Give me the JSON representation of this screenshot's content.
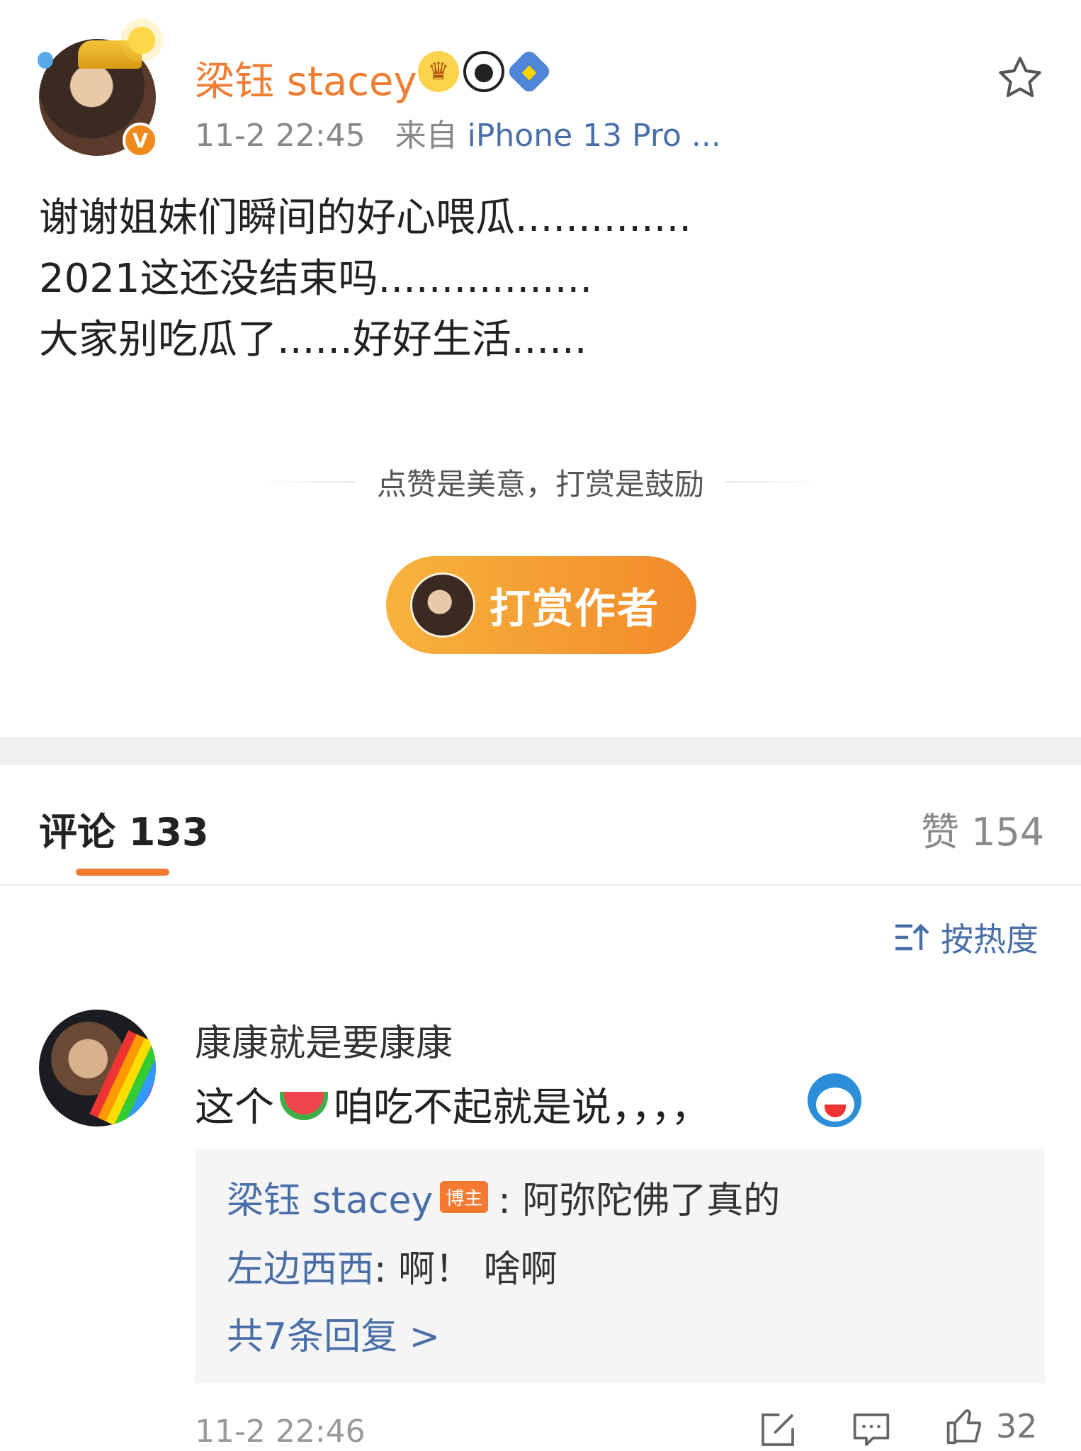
{
  "post": {
    "author": "梁钰 stacey",
    "time": "11-2 22:45",
    "source_prefix": "来自",
    "source": "iPhone 13 Pro ...",
    "text": "谢谢姐妹们瞬间的好心喂瓜..............\n2021这还没结束吗.................\n大家别吃瓜了......好好生活......",
    "badges": [
      "crown-icon",
      "panda-icon",
      "shield-icon"
    ],
    "verified_badge": "V"
  },
  "reward": {
    "slogan": "点赞是美意，打赏是鼓励",
    "button_label": "打赏作者"
  },
  "tabs": {
    "comments": "评论 133",
    "likes": "赞 154"
  },
  "sort": {
    "label": "按热度"
  },
  "comment": {
    "author": "康康就是要康康",
    "text_before": "这个",
    "text_after": "咱吃不起就是说，，，，",
    "emojis": [
      "watermelon-icon",
      "doraemon-icon"
    ],
    "replies": [
      {
        "author": "梁钰 stacey",
        "tag": "博主",
        "text": ": 阿弥陀佛了真的"
      },
      {
        "author": "左边西西",
        "text": ": 啊！ 啥啊"
      }
    ],
    "more_replies": "共7条回复 >",
    "time": "11-2 22:46",
    "likes": "32"
  },
  "colors": {
    "accent": "#f0782f",
    "username": "#ef7d33",
    "link": "#4a6fa8"
  }
}
